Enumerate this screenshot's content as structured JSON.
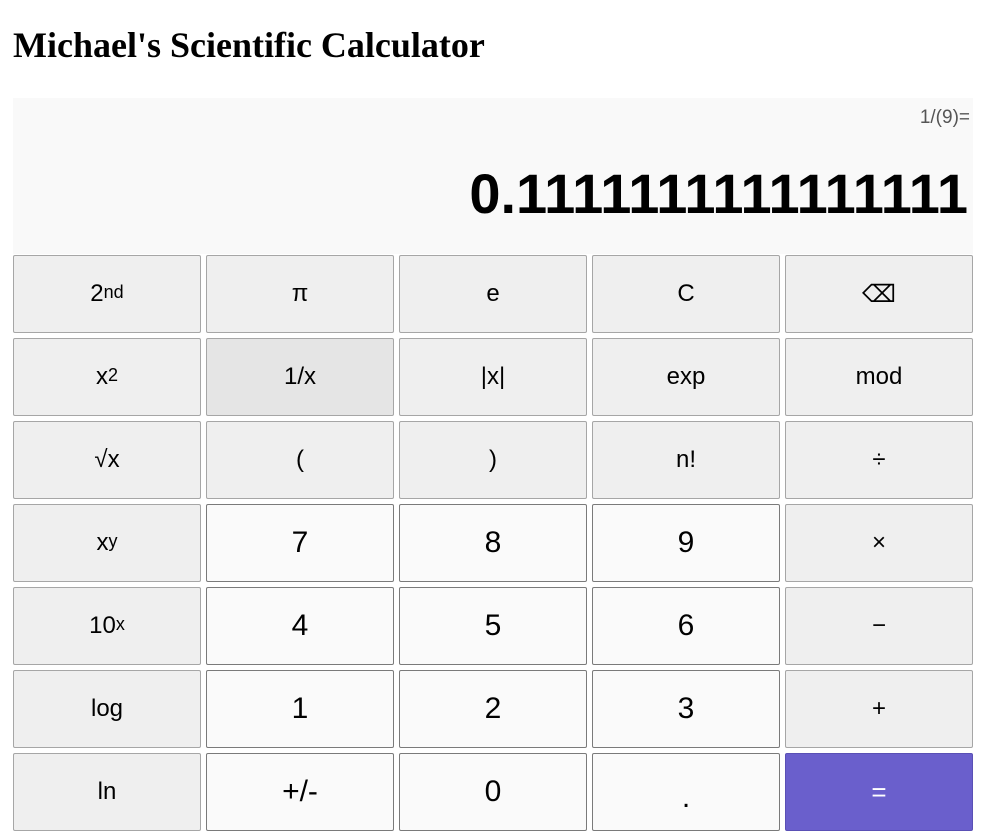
{
  "app": {
    "title": "Michael's Scientific Calculator"
  },
  "display": {
    "expression": "1/(9)=",
    "result": "0.1111111111111111"
  },
  "keys": {
    "second": {
      "base": "2",
      "sup": "nd"
    },
    "pi": "π",
    "e": "e",
    "clear": "C",
    "backspace": "⌫",
    "square": {
      "base": "x",
      "sup": "2"
    },
    "reciprocal": "1/x",
    "abs": "|x|",
    "exp": "exp",
    "mod": "mod",
    "sqrt": "√x",
    "open_paren": "(",
    "close_paren": ")",
    "factorial": "n!",
    "divide": "÷",
    "power": {
      "base": "x",
      "sup": "y"
    },
    "seven": "7",
    "eight": "8",
    "nine": "9",
    "multiply": "×",
    "ten_power": {
      "base": "10",
      "sup": "x"
    },
    "four": "4",
    "five": "5",
    "six": "6",
    "minus": "−",
    "log": "log",
    "one": "1",
    "two": "2",
    "three": "3",
    "plus": "+",
    "ln": "ln",
    "negate": "+/-",
    "zero": "0",
    "decimal": ".",
    "equals": "="
  },
  "colors": {
    "equals_bg": "#6a5fcc",
    "function_key_bg": "#efefef",
    "digit_key_bg": "#fafafa",
    "display_bg": "#f9f9f9"
  }
}
